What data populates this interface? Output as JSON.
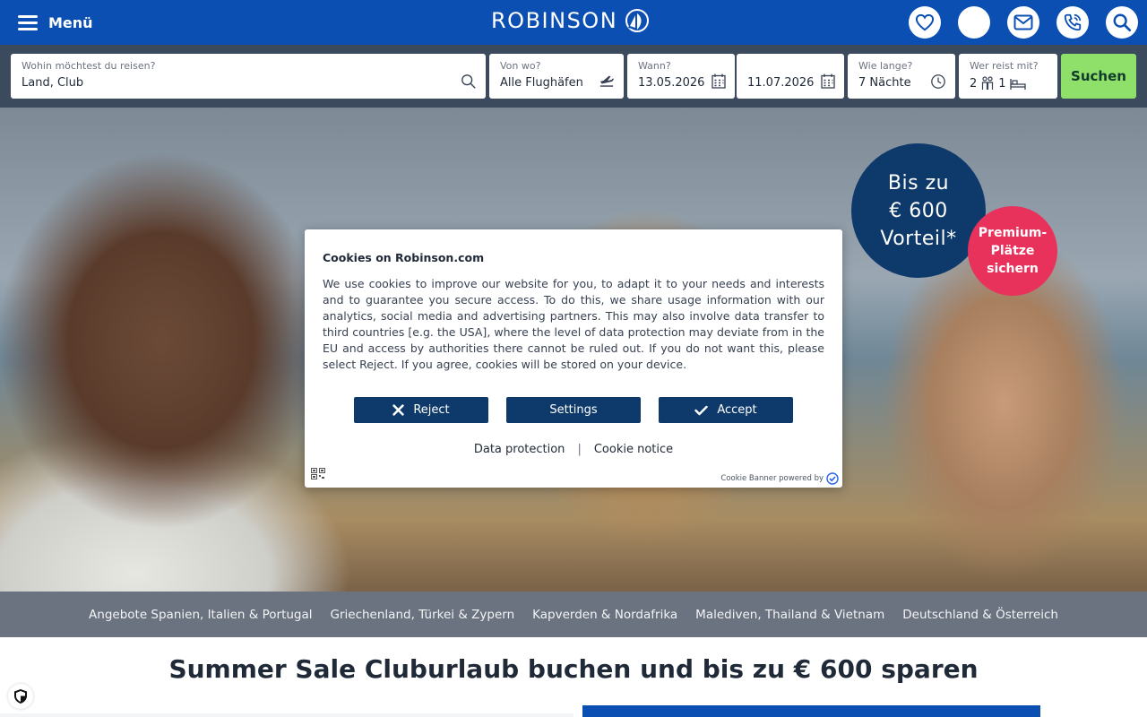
{
  "header": {
    "menu_label": "Menü",
    "logo_text": "ROBINSON",
    "icons": [
      "heart-icon",
      "account-icon",
      "mail-icon",
      "phone-icon",
      "search-icon"
    ]
  },
  "search": {
    "destination": {
      "label": "Wohin möchtest du reisen?",
      "value": "Land, Club"
    },
    "departure": {
      "label": "Von wo?",
      "value": "Alle Flughäfen"
    },
    "date_from": {
      "label": "Wann?",
      "value": "13.05.2026"
    },
    "date_to": {
      "label": "",
      "value": "11.07.2026"
    },
    "duration": {
      "label": "Wie lange?",
      "value": "7 Nächte"
    },
    "travelers": {
      "label": "Wer reist mit?",
      "adults": "2",
      "rooms": "1"
    },
    "submit_label": "Suchen"
  },
  "promo": {
    "blue_lines": [
      "Bis zu",
      "€ 600",
      "Vorteil*"
    ],
    "pink_lines": [
      "Premium-",
      "Plätze",
      "sichern"
    ]
  },
  "cookie": {
    "title": "Cookies on Robinson.com",
    "body": "We use cookies to improve our website for you, to adapt it to your needs and interests and to guarantee you secure access. To do this, we share usage information with our analytics, social media and advertising partners. This may also involve data transfer to third countries [e.g. the USA], where the level of data protection may deviate from in the EU and access by authorities there cannot be ruled out. If you do not want this, please select Reject. If you agree, cookies will be stored on your device.",
    "reject_label": "Reject",
    "settings_label": "Settings",
    "accept_label": "Accept",
    "data_protection_label": "Data protection",
    "separator": "|",
    "cookie_notice_label": "Cookie notice",
    "powered_by": "Cookie Banner powered by"
  },
  "nav": {
    "links": [
      "Angebote Spanien, Italien & Portugal",
      "Griechenland, Türkei & Zypern",
      "Kapverden & Nordafrika",
      "Malediven, Thailand & Vietnam",
      "Deutschland & Österreich"
    ]
  },
  "headline": "Summer Sale Cluburlaub buchen und bis zu € 600 sparen",
  "colors": {
    "brand_blue": "#0b4fb3",
    "dark_navy": "#0e3a6b",
    "search_green": "#8ee06a",
    "promo_pink": "#e8325c",
    "nav_gray": "#6b7280"
  }
}
